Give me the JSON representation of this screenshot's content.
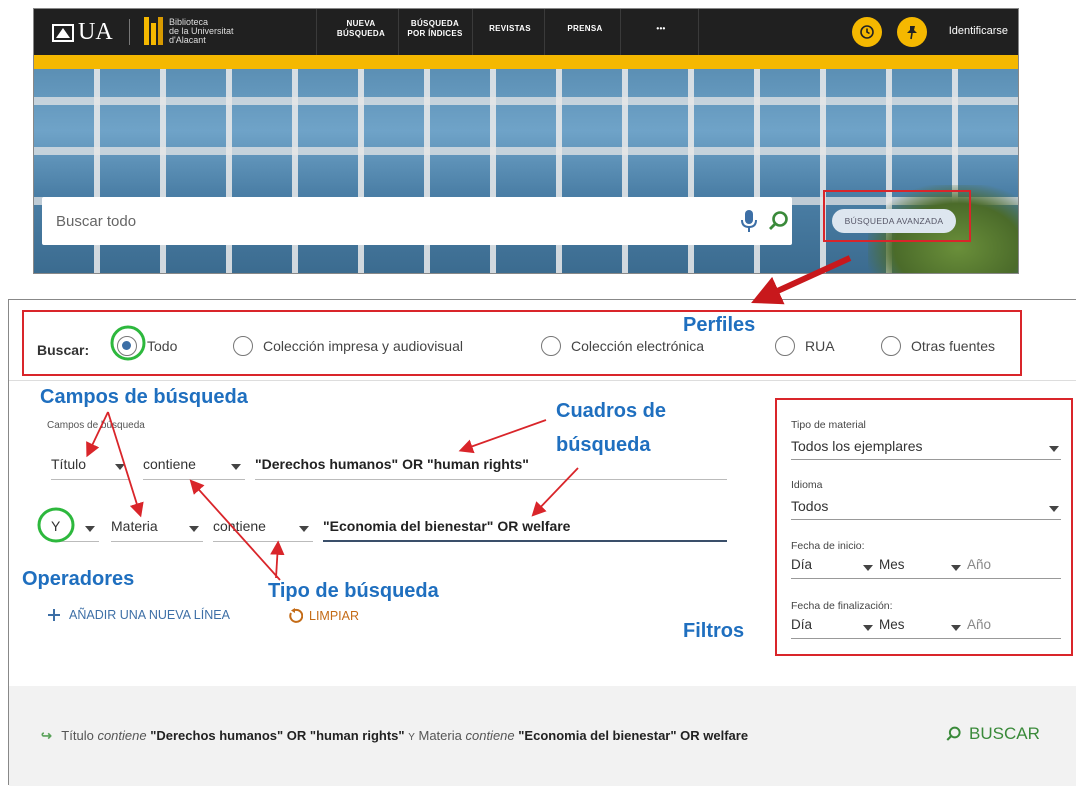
{
  "header": {
    "logo_text": "UA",
    "library_lines": [
      "Biblioteca",
      "de la Universitat",
      "d'Alacant"
    ],
    "nav": [
      {
        "line1": "NUEVA",
        "line2": "BÚSQUEDA"
      },
      {
        "line1": "BÚSQUEDA",
        "line2": "POR ÍNDICES"
      },
      {
        "line1": "REVISTAS",
        "line2": ""
      },
      {
        "line1": "PRENSA",
        "line2": ""
      },
      {
        "line1": "•••",
        "line2": ""
      }
    ],
    "login_label": "Identificarse",
    "history_icon": "history-icon",
    "pin_icon": "pin-icon",
    "yellow": "#f5b800",
    "dark": "#202020"
  },
  "search": {
    "placeholder": "Buscar todo",
    "advanced_label": "BÚSQUEDA AVANZADA"
  },
  "advanced": {
    "buscar_label": "Buscar:",
    "profiles": [
      {
        "label": "Todo",
        "selected": true
      },
      {
        "label": "Colección impresa y audiovisual",
        "selected": false
      },
      {
        "label": "Colección electrónica",
        "selected": false
      },
      {
        "label": "RUA",
        "selected": false
      },
      {
        "label": "Otras fuentes",
        "selected": false
      }
    ],
    "fields_label": "Campos de búsqueda",
    "rows": [
      {
        "operator": "",
        "field": "Título",
        "type": "contiene",
        "query": "\"Derechos humanos\" OR \"human rights\""
      },
      {
        "operator": "Y",
        "field": "Materia",
        "type": "contiene",
        "query": "\"Economia del bienestar\" OR welfare"
      }
    ],
    "add_line_label": "AÑADIR UNA NUEVA LÍNEA",
    "clear_label": "LIMPIAR"
  },
  "filters": {
    "material_label": "Tipo de material",
    "material_value": "Todos los ejemplares",
    "language_label": "Idioma",
    "language_value": "Todos",
    "start_label": "Fecha de inicio:",
    "end_label": "Fecha de finalización:",
    "day": "Día",
    "month": "Mes",
    "year": "Año"
  },
  "summary": {
    "field1": "Título",
    "op1": "contiene",
    "q1": "\"Derechos humanos\" OR \"human rights\"",
    "joiner": "Y",
    "field2": "Materia",
    "op2": "contiene",
    "q2": "\"Economia del bienestar\" OR welfare",
    "search_label": "BUSCAR"
  },
  "annotations": {
    "perfiles": "Perfiles",
    "campos": "Campos de búsqueda",
    "cuadros_l1": "Cuadros de",
    "cuadros_l2": "búsqueda",
    "operadores": "Operadores",
    "tipo": "Tipo de búsqueda",
    "filtros": "Filtros",
    "red": "#d9252a",
    "green": "#2db83d",
    "blue": "#1f6fbf"
  }
}
